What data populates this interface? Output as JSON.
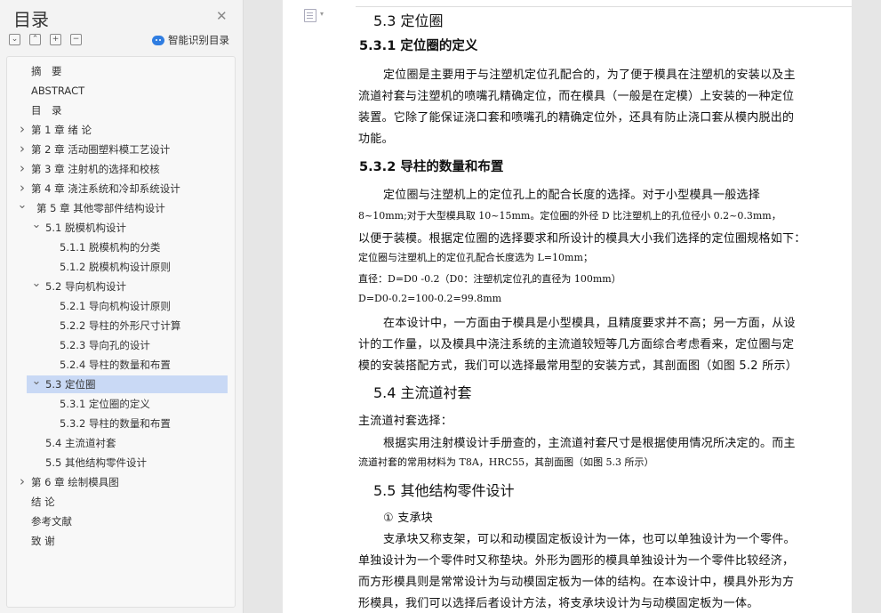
{
  "sidebar": {
    "title": "目录",
    "close_icon": "close-icon",
    "tools": [
      "−",
      "^",
      "+",
      "−"
    ],
    "smart_label": "智能识别目录",
    "toc": [
      {
        "label": "摘　要",
        "level": 0,
        "caret": ""
      },
      {
        "label": "ABSTRACT",
        "level": 0,
        "caret": ""
      },
      {
        "label": "目　录",
        "level": 0,
        "caret": ""
      },
      {
        "label": "第 1 章  绪  论",
        "level": 0,
        "caret": ">"
      },
      {
        "label": "第 2 章  活动圈塑料模工艺设计",
        "level": 0,
        "caret": ">"
      },
      {
        "label": "第 3 章  注射机的选择和校核",
        "level": 0,
        "caret": ">"
      },
      {
        "label": "第 4 章  浇注系统和冷却系统设计",
        "level": 0,
        "caret": ">"
      },
      {
        "label": "第 5 章  其他零部件结构设计",
        "level": 0,
        "caret": "v"
      },
      {
        "label": "5.1 脱模机构设计",
        "level": 1,
        "caret": "v"
      },
      {
        "label": "5.1.1 脱模机构的分类",
        "level": 2,
        "caret": ""
      },
      {
        "label": "5.1.2 脱模机构设计原则",
        "level": 2,
        "caret": ""
      },
      {
        "label": "5.2 导向机构设计",
        "level": 1,
        "caret": "v"
      },
      {
        "label": "5.2.1 导向机构设计原则",
        "level": 2,
        "caret": ""
      },
      {
        "label": "5.2.2 导柱的外形尺寸计算",
        "level": 2,
        "caret": ""
      },
      {
        "label": "5.2.3 导向孔的设计",
        "level": 2,
        "caret": ""
      },
      {
        "label": "5.2.4 导柱的数量和布置",
        "level": 2,
        "caret": ""
      },
      {
        "label": "5.3 定位圈",
        "level": 1,
        "caret": "v",
        "selected": true
      },
      {
        "label": "5.3.1 定位圈的定义",
        "level": 2,
        "caret": ""
      },
      {
        "label": "5.3.2 导柱的数量和布置",
        "level": 2,
        "caret": ""
      },
      {
        "label": "5.4 主流道衬套",
        "level": 1,
        "caret": ""
      },
      {
        "label": "5.5 其他结构零件设计",
        "level": 1,
        "caret": ""
      },
      {
        "label": "第 6 章    绘制模具图",
        "level": 0,
        "caret": ">"
      },
      {
        "label": "结  论",
        "level": 0,
        "caret": ""
      },
      {
        "label": "参考文献",
        "level": 0,
        "caret": ""
      },
      {
        "label": "致  谢",
        "level": 0,
        "caret": ""
      }
    ]
  },
  "document": {
    "lines": [
      {
        "text": "5.3 定位圈",
        "style": "h2"
      },
      {
        "text": "5.3.1 定位圈的定义",
        "style": "h3"
      },
      {
        "text": "定位圈是主要用于与注塑机定位孔配合的，为了便于模具在注塑机的安装以及主",
        "style": "p"
      },
      {
        "text": "流道衬套与注塑机的喷嘴孔精确定位，而在模具（一般是在定模）上安装的一种定位",
        "style": "p"
      },
      {
        "text": "装置。它除了能保证浇口套和喷嘴孔的精确定位外，还具有防止浇口套从模内脱出的",
        "style": "p"
      },
      {
        "text": "功能。",
        "style": "p"
      },
      {
        "text": "5.3.2 导柱的数量和布置",
        "style": "h3"
      },
      {
        "text": "定位圈与注塑机上的定位孔上的配合长度的选择。对于小型模具一般选择",
        "style": "p"
      },
      {
        "text": "8~10mm;对于大型模具取 10~15mm。定位圈的外径 D 比注塑机上的孔位径小 0.2~0.3mm，",
        "style": "m"
      },
      {
        "text": "以便于装模。根据定位圈的选择要求和所设计的模具大小我们选择的定位圈规格如下：",
        "style": "p"
      },
      {
        "text": "定位圈与注塑机上的定位孔配合长度选为 L=10mm；",
        "style": "m"
      },
      {
        "text": "直径：D=D0 -0.2（D0：注塑机定位孔的直径为 100mm）",
        "style": "m"
      },
      {
        "text": "D=D0-0.2=100-0.2=99.8mm",
        "style": "m"
      },
      {
        "text": "在本设计中，一方面由于模具是小型模具，且精度要求并不高；另一方面，从设",
        "style": "p"
      },
      {
        "text": "计的工作量，以及模具中浇注系统的主流道较短等几方面综合考虑看来，定位圈与定",
        "style": "p"
      },
      {
        "text": "模的安装搭配方式，我们可以选择最常用型的安装方式，其剖面图（如图 5.2 所示）",
        "style": "p"
      },
      {
        "text": "5.4 主流道衬套",
        "style": "h2"
      },
      {
        "text": "主流道衬套选择：",
        "style": "p"
      },
      {
        "text": "根据实用注射模设计手册查的，主流道衬套尺寸是根据使用情况所决定的。而主",
        "style": "p"
      },
      {
        "text": "流道衬套的常用材料为 T8A，HRC55，其剖面图（如图 5.3 所示）",
        "style": "m"
      },
      {
        "text": "5.5 其他结构零件设计",
        "style": "h2"
      },
      {
        "text": "① 支承块",
        "style": "p"
      },
      {
        "text": "支承块又称支架，可以和动模固定板设计为一体，也可以单独设计为一个零件。",
        "style": "p"
      },
      {
        "text": "单独设计为一个零件时又称垫块。外形为圆形的模具单独设计为一个零件比较经济，",
        "style": "p"
      },
      {
        "text": "而方形模具则是常常设计为与动模固定板为一体的结构。在本设计中，模具外形为方",
        "style": "p"
      },
      {
        "text": "形模具，我们可以选择后者设计方法，将支承块设计为与动模固定板为一体。",
        "style": "p"
      }
    ]
  }
}
